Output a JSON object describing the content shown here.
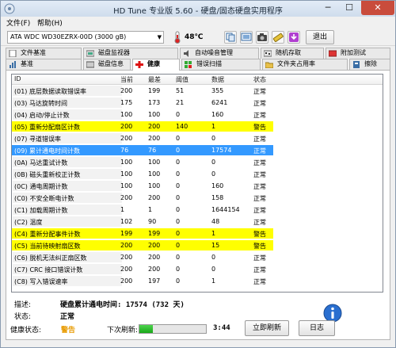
{
  "window": {
    "title": "HD Tune 专业版 5.60 - 硬盘/固态硬盘实用程序",
    "minimize_glyph": "─",
    "maximize_glyph": "☐",
    "close_glyph": "✕"
  },
  "menu": [
    {
      "label": "文件(F)"
    },
    {
      "label": "帮助(H)"
    }
  ],
  "toolbar": {
    "drive": "ATA    WDC WD30EZRX-00D (3000 gB)",
    "temperature": "48℃",
    "icons": [
      "copy-icon",
      "copy-screen-icon",
      "camera-icon",
      "options-icon",
      "download-icon"
    ],
    "exit_label": "退出"
  },
  "tabs_top": [
    {
      "label": "文件基准",
      "icon": "file-benchmark-icon"
    },
    {
      "label": "磁盘监视器",
      "icon": "disk-monitor-icon"
    },
    {
      "label": "自动噪音管理",
      "icon": "aam-icon"
    },
    {
      "label": "随机存取",
      "icon": "random-access-icon"
    },
    {
      "label": "附加测试",
      "icon": "extra-tests-icon"
    }
  ],
  "tabs_bottom": [
    {
      "label": "基准",
      "icon": "benchmark-icon"
    },
    {
      "label": "磁盘信息",
      "icon": "disk-info-icon"
    },
    {
      "label": "健康",
      "icon": "health-icon"
    },
    {
      "label": "错误扫描",
      "icon": "error-scan-icon"
    },
    {
      "label": "文件夹占用率",
      "icon": "folder-usage-icon"
    },
    {
      "label": "擦除",
      "icon": "erase-icon"
    }
  ],
  "smart": {
    "headers": [
      "ID",
      "当前",
      "最差",
      "阈值",
      "数据",
      "状态"
    ],
    "rows": [
      {
        "id": "(01) 底层数据读取错误率",
        "current": "200",
        "worst": "199",
        "threshold": "51",
        "data": "355",
        "status": "正常",
        "level": "ok"
      },
      {
        "id": "(03) 马达旋转时间",
        "current": "175",
        "worst": "173",
        "threshold": "21",
        "data": "6241",
        "status": "正常",
        "level": "ok"
      },
      {
        "id": "(04) 启动/停止计数",
        "current": "100",
        "worst": "100",
        "threshold": "0",
        "data": "160",
        "status": "正常",
        "level": "ok"
      },
      {
        "id": "(05) 重新分配扇区计数",
        "current": "200",
        "worst": "200",
        "threshold": "140",
        "data": "1",
        "status": "警告",
        "level": "warn"
      },
      {
        "id": "(07) 寻道错误率",
        "current": "200",
        "worst": "200",
        "threshold": "0",
        "data": "0",
        "status": "正常",
        "level": "ok"
      },
      {
        "id": "(09) 累计通电时间计数",
        "current": "76",
        "worst": "76",
        "threshold": "0",
        "data": "17574",
        "status": "正常",
        "level": "selected"
      },
      {
        "id": "(0A) 马达重试计数",
        "current": "100",
        "worst": "100",
        "threshold": "0",
        "data": "0",
        "status": "正常",
        "level": "ok"
      },
      {
        "id": "(0B) 磁头重新校正计数",
        "current": "100",
        "worst": "100",
        "threshold": "0",
        "data": "0",
        "status": "正常",
        "level": "ok"
      },
      {
        "id": "(0C) 通电周期计数",
        "current": "100",
        "worst": "100",
        "threshold": "0",
        "data": "160",
        "status": "正常",
        "level": "ok"
      },
      {
        "id": "(C0) 不安全断电计数",
        "current": "200",
        "worst": "200",
        "threshold": "0",
        "data": "158",
        "status": "正常",
        "level": "ok"
      },
      {
        "id": "(C1) 加载周期计数",
        "current": "1",
        "worst": "1",
        "threshold": "0",
        "data": "1644154",
        "status": "正常",
        "level": "ok"
      },
      {
        "id": "(C2) 温度",
        "current": "102",
        "worst": "90",
        "threshold": "0",
        "data": "48",
        "status": "正常",
        "level": "ok"
      },
      {
        "id": "(C4) 重新分配事件计数",
        "current": "199",
        "worst": "199",
        "threshold": "0",
        "data": "1",
        "status": "警告",
        "level": "warn"
      },
      {
        "id": "(C5) 当前待映射扇区数",
        "current": "200",
        "worst": "200",
        "threshold": "0",
        "data": "15",
        "status": "警告",
        "level": "warn"
      },
      {
        "id": "(C6) 脱机无法纠正扇区数",
        "current": "200",
        "worst": "200",
        "threshold": "0",
        "data": "0",
        "status": "正常",
        "level": "ok"
      },
      {
        "id": "(C7) CRC 接口错误计数",
        "current": "200",
        "worst": "200",
        "threshold": "0",
        "data": "0",
        "status": "正常",
        "level": "ok"
      },
      {
        "id": "(C8) 写入错误速率",
        "current": "200",
        "worst": "197",
        "threshold": "0",
        "data": "1",
        "status": "正常",
        "level": "ok"
      }
    ]
  },
  "details": {
    "description_label": "描述:",
    "description_value": "硬盘累计通电时间: 17574 (732 天)",
    "state_label": "状态:",
    "state_value": "正常"
  },
  "status_bar": {
    "health_label": "健康状态:",
    "health_value": "警告",
    "health_color": "#e89a00",
    "next_refresh_label": "下次刷新:",
    "refresh_fraction": 0.2,
    "countdown": "3:44",
    "refresh_button": "立即刷新",
    "log_button": "日志"
  }
}
